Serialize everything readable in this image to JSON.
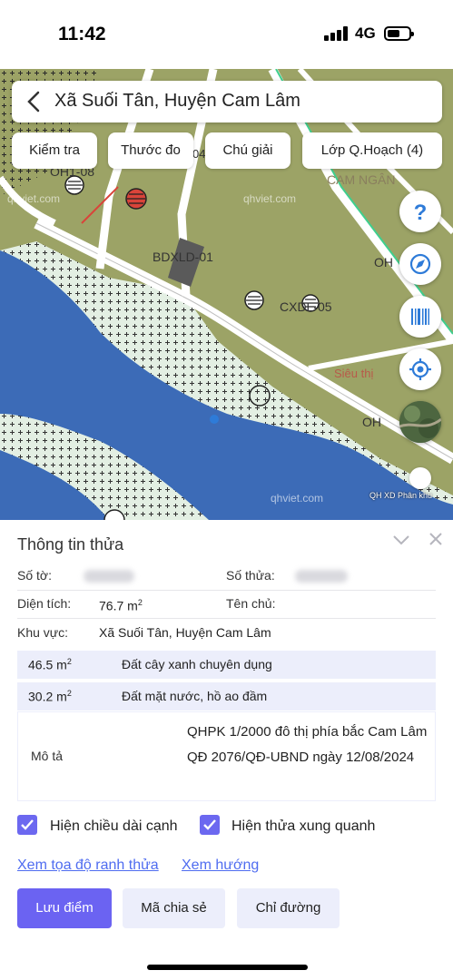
{
  "status": {
    "time": "11:42",
    "network": "4G"
  },
  "map": {
    "labels": [
      {
        "text": "OH1-08",
        "name": "map-label-oh1-08"
      },
      {
        "text": "BDXLD-01",
        "name": "map-label-bdxld-01"
      },
      {
        "text": "CXDL-05",
        "name": "map-label-cxdl-05"
      },
      {
        "text": "OH",
        "name": "map-label-oh"
      },
      {
        "text": "OH",
        "name": "map-label-oh-2"
      },
      {
        "text": "CAM NGÂN",
        "name": "map-label-cam-ngan"
      },
      {
        "text": "Siêu thị",
        "name": "map-label-sieu-thi"
      },
      {
        "text": "04",
        "name": "map-label-04"
      }
    ],
    "watermark": "qhviet.com",
    "credit": "QH XD Phân khu",
    "colors": {
      "land": "#9ca366",
      "water": "#3c6bb7",
      "green_zone": "#e3efe3",
      "road": "#ffffff",
      "accent": "#2e7bd8"
    }
  },
  "search": {
    "title": "Xã Suối Tân, Huyện Cam Lâm",
    "back_icon": "chevron-left-icon"
  },
  "toolbar": {
    "check": "Kiểm tra",
    "ruler": "Thước đo",
    "legend": "Chú giải",
    "layer": "Lớp Q.Hoạch (4)"
  },
  "fabs": [
    "help-icon",
    "compass-icon",
    "barcode-icon",
    "locate-icon",
    "satellite-icon"
  ],
  "panel": {
    "title": "Thông tin thửa",
    "sheet_label": "Số tờ:",
    "parcel_label": "Số thửa:",
    "area_label": "Diện tích:",
    "area_value": "76.7 m",
    "area_sup": "2",
    "owner_label": "Tên chủ:",
    "region_label": "Khu vực:",
    "region_value": "Xã Suối Tân, Huyện Cam Lâm",
    "land_uses": [
      {
        "area": "46.5 m",
        "sup": "2",
        "type": "Đất cây xanh chuyên dụng"
      },
      {
        "area": "30.2 m",
        "sup": "2",
        "type": "Đất mặt nước, hồ ao đầm"
      }
    ],
    "desc_label": "Mô tả",
    "desc_value": "QHPK 1/2000 đô thị phía bắc Cam Lâm QĐ 2076/QĐ-UBND ngày 12/08/2024",
    "show_edges": "Hiện chiều dài cạnh",
    "show_neighbors": "Hiện thửa xung quanh",
    "coords_link": "Xem tọa độ ranh thửa",
    "direction_link": "Xem hướng",
    "save_btn": "Lưu điểm",
    "share_btn": "Mã chia sẻ",
    "route_btn": "Chỉ đường"
  }
}
